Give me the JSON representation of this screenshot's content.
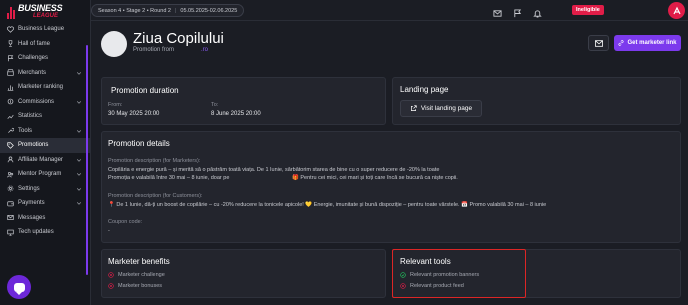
{
  "brand": {
    "line1": "BUSINESS",
    "line2": "LEAGUE",
    "accent": "#e11d48"
  },
  "sidebar": {
    "items": [
      {
        "label": "Business League",
        "icon": "heart-icon",
        "chevron": false
      },
      {
        "label": "Hall of fame",
        "icon": "trophy-icon",
        "chevron": false
      },
      {
        "label": "Challenges",
        "icon": "flag-icon",
        "chevron": false
      },
      {
        "label": "Merchants",
        "icon": "store-icon",
        "chevron": true
      },
      {
        "label": "Marketer ranking",
        "icon": "ranking-icon",
        "chevron": false
      },
      {
        "label": "Commissions",
        "icon": "commissions-icon",
        "chevron": true
      },
      {
        "label": "Statistics",
        "icon": "statistics-icon",
        "chevron": false
      },
      {
        "label": "Tools",
        "icon": "tools-icon",
        "chevron": true
      },
      {
        "label": "Promotions",
        "icon": "tag-icon",
        "chevron": false,
        "active": true
      },
      {
        "label": "Affiliate Manager",
        "icon": "user-icon",
        "chevron": true
      },
      {
        "label": "Mentor Program",
        "icon": "mentor-icon",
        "chevron": true
      },
      {
        "label": "Settings",
        "icon": "gear-icon",
        "chevron": true
      },
      {
        "label": "Payments",
        "icon": "wallet-icon",
        "chevron": true
      },
      {
        "label": "Messages",
        "icon": "envelope-icon",
        "chevron": false
      },
      {
        "label": "Tech updates",
        "icon": "monitor-icon",
        "chevron": false
      }
    ]
  },
  "topbar": {
    "season": "Season 4 • Stage 2 • Round 2",
    "dates": "05.05.2025-02.06.2025",
    "status_badge": "Ineligible"
  },
  "header": {
    "title": "Ziua Copilului",
    "from_label": "Promotion from",
    "from_domain": ".ro",
    "marketer_link_button": "Get marketer link"
  },
  "duration": {
    "title": "Promotion duration",
    "from_label": "From:",
    "from_value": "30 May 2025 20:00",
    "to_label": "To:",
    "to_value": "8 June 2025 20:00"
  },
  "landing": {
    "title": "Landing page",
    "button": "Visit landing page"
  },
  "details": {
    "title": "Promotion details",
    "marketers_label": "Promotion description (for Marketers):",
    "marketers_line1": "Copilăria e energie pură – și merită să o păstrăm toată viața. De 1 Iunie, sărbătorim starea de bine cu o super reducere de -20% la toate",
    "marketers_line2a": "Promoția e valabilă între 30 mai – 8 iunie, doar pe",
    "marketers_line2b": "🎁 Pentru cei mici, cei mari și toți care încă se bucură ca niște copii.",
    "customers_label": "Promotion description (for Customers):",
    "customers_line": "📍 De 1 Iunie, dă-ți un boost de copilărie – cu -20% reducere la tonicele apicole! 💛 Energie, imunitate și bună dispoziție – pentru toate vârstele. 📅 Promo valabilă 30 mai – 8 iunie",
    "coupon_label": "Coupon code:",
    "coupon_value": "-"
  },
  "benefits": {
    "title": "Marketer benefits",
    "items": [
      "Marketer challenge",
      "Marketer bonuses"
    ]
  },
  "tools": {
    "title": "Relevant tools",
    "items": [
      "Relevant promotion banners",
      "Relevant product feed"
    ]
  },
  "colors": {
    "primary": "#7c3aed",
    "danger": "#e11d48",
    "background": "#1b1d24",
    "card": "#23252d"
  }
}
